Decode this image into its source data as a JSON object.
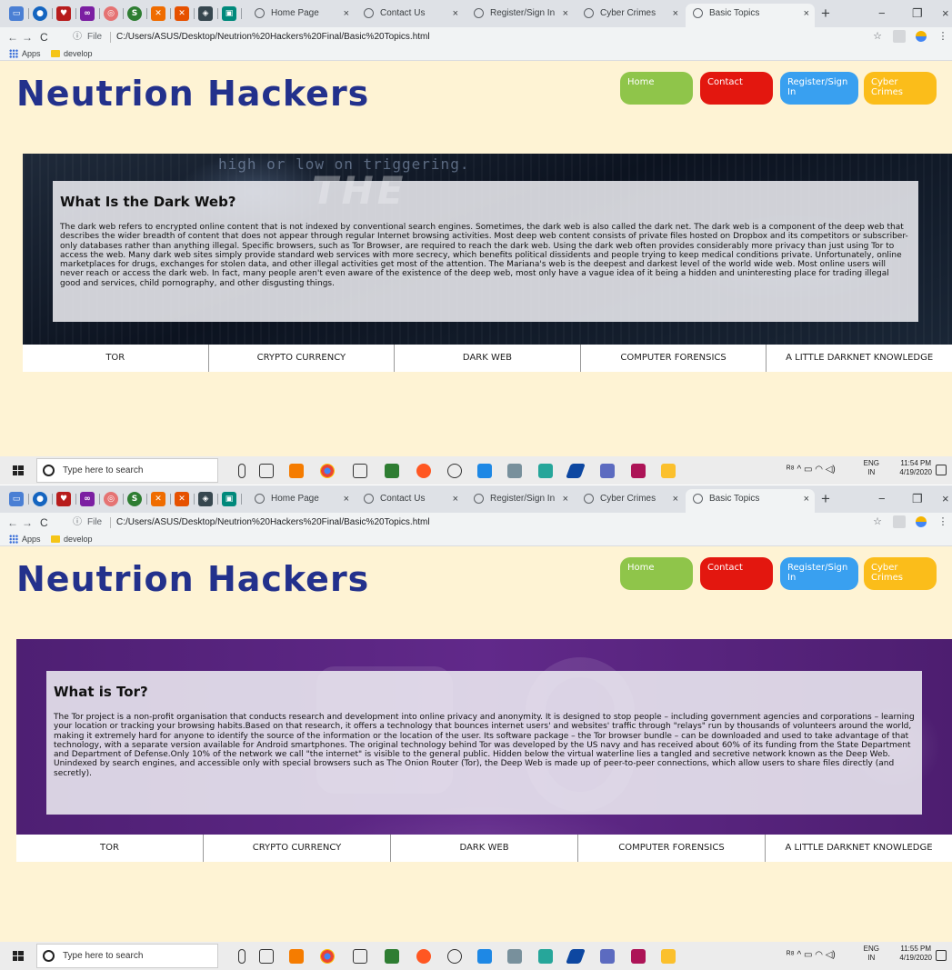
{
  "browser": {
    "tabs": [
      {
        "title": "Home Page",
        "active": false
      },
      {
        "title": "Contact Us",
        "active": false
      },
      {
        "title": "Register/Sign In",
        "active": false
      },
      {
        "title": "Cyber Crimes",
        "active": false
      },
      {
        "title": "Basic Topics",
        "active": true
      }
    ],
    "tab_close": "×",
    "new_tab": "+",
    "minimize": "−",
    "maximize": "❐",
    "close": "×",
    "url_scheme": "File",
    "url": "C:/Users/ASUS/Desktop/Neutrion%20Hackers%20Final/Basic%20Topics.html",
    "bookmarks": {
      "apps": "Apps",
      "folder": "develop"
    },
    "nav": {
      "back": "←",
      "forward": "→",
      "reload": "C"
    }
  },
  "site": {
    "logo": "Neutrion Hackers",
    "nav": {
      "home": "Home",
      "contact": "Contact",
      "register": "Register/Sign In",
      "cyber": "Cyber Crimes"
    },
    "menu": [
      "TOR",
      "CRYPTO CURRENCY",
      "DARK WEB",
      "COMPUTER FORENSICS",
      "A LITTLE DARKNET KNOWLEDGE"
    ]
  },
  "screens": [
    {
      "hero_bg_text": "high or low on triggering.",
      "hero_big_word": "THE",
      "heading": "What Is the Dark Web?",
      "body": "The dark web refers to encrypted online content that is not indexed by conventional search engines. Sometimes, the dark web is also called the dark net. The dark web is a component of the deep web that describes the wider breadth of content that does not appear through regular Internet browsing activities. Most deep web content consists of private files hosted on Dropbox and its competitors or subscriber-only databases rather than anything illegal. Specific browsers, such as Tor Browser, are required to reach the dark web. Using the dark web often provides considerably more privacy than just using Tor to access the web. Many dark web sites simply provide standard web services with more secrecy, which benefits political dissidents and people trying to keep medical conditions private. Unfortunately, online marketplaces for drugs, exchanges for stolen data, and other illegal activities get most of the attention. The Mariana's web is the deepest and darkest level of the world wide web. Most online users will never reach or access the dark web. In fact, many people aren't even aware of the existence of the deep web, most only have a vague idea of it being a hidden and uninteresting place for trading illegal good and services, child pornography, and other disgusting things.",
      "clock_time": "11:54 PM",
      "clock_date": "4/19/2020"
    },
    {
      "heading": "What is Tor?",
      "body": "The Tor project is a non-profit organisation that conducts research and development into online privacy and anonymity. It is designed to stop people – including government agencies and corporations – learning your location or tracking your browsing habits.Based on that research, it offers a technology that bounces internet users' and websites' traffic through \"relays\" run by thousands of volunteers around the world, making it extremely hard for anyone to identify the source of the information or the location of the user. Its software package – the Tor browser bundle – can be downloaded and used to take advantage of that technology, with a separate version available for Android smartphones. The original technology behind Tor was developed by the US navy and has received about 60% of its funding from the State Department and Department of Defense.Only 10% of the network we call \"the internet\" is visible to the general public. Hidden below the virtual waterline lies a tangled and secretive network known as the Deep Web. Unindexed by search engines, and accessible only with special browsers such as The Onion Router (Tor), the Deep Web is made up of peer-to-peer connections, which allow users to share files directly (and secretly).",
      "clock_time": "11:55 PM",
      "clock_date": "4/19/2020"
    }
  ],
  "taskbar": {
    "search_placeholder": "Type here to search",
    "lang_top": "ENG",
    "lang_bottom": "IN",
    "tray_icons": "ᴿ⁸  ^  ▭  ◠  ◁)"
  },
  "colors": {
    "page_bg": "#fef3d4",
    "logo": "#23318c",
    "home": "#8fc54a",
    "contact": "#e3170f",
    "register": "#39a0f0",
    "cyber": "#fbbd1a"
  }
}
